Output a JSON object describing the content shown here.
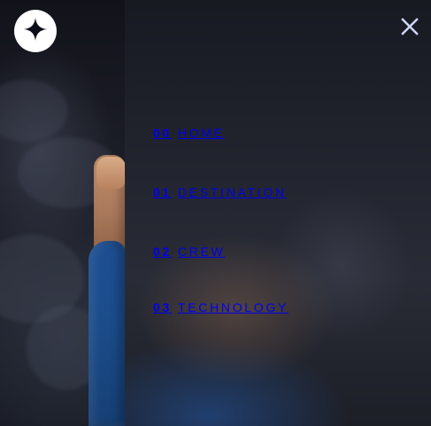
{
  "brand": {
    "logo": "star-icon"
  },
  "controls": {
    "close_icon": "close-icon"
  },
  "navigation": {
    "items": [
      {
        "number": "00",
        "label": "HOME"
      },
      {
        "number": "01",
        "label": "DESTINATION"
      },
      {
        "number": "02",
        "label": "CREW"
      },
      {
        "number": "03",
        "label": "TECHNOLOGY"
      }
    ]
  },
  "colors": {
    "menu_text": "#ffffff",
    "close_icon": "#d0d6f9",
    "panel_overlay": "#242632"
  }
}
